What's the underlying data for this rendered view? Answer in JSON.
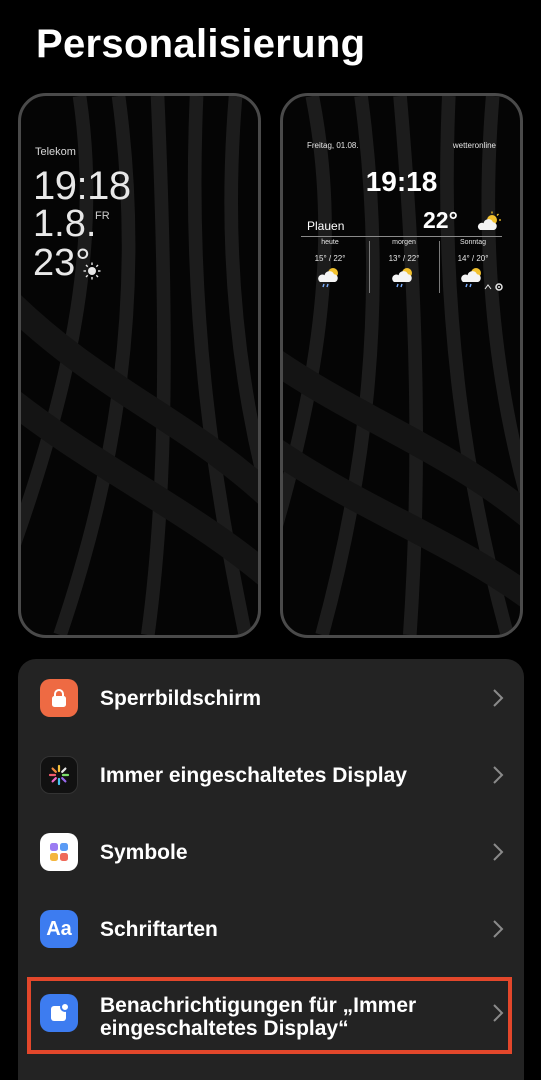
{
  "header": {
    "title": "Personalisierung"
  },
  "preview_aod": {
    "carrier": "Telekom",
    "time": "19:18",
    "date": "1.8.",
    "day": "FR",
    "temperature": "23°",
    "weather_icon": "sun-icon"
  },
  "preview_widget": {
    "date": "Freitag, 01.08.",
    "brand": "wetteronline",
    "time": "19:18",
    "city": "Plauen",
    "temperature": "22°",
    "forecast": [
      {
        "label": "heute",
        "temps": "15° / 22°",
        "icon": "partly-cloudy-rain-icon"
      },
      {
        "label": "morgen",
        "temps": "13° / 22°",
        "icon": "partly-cloudy-rain-icon"
      },
      {
        "label": "Sonntag",
        "temps": "14° / 20°",
        "icon": "partly-cloudy-rain-icon"
      }
    ]
  },
  "menu": {
    "items": [
      {
        "label": "Sperrbildschirm",
        "icon": "lock-icon"
      },
      {
        "label": "Immer eingeschaltetes Display",
        "icon": "aod-icon"
      },
      {
        "label": "Symbole",
        "icon": "grid-icon"
      },
      {
        "label": "Schriftarten",
        "icon": "font-icon",
        "icon_text": "Aa"
      },
      {
        "label": "Benachrichtigungen für „Immer eingeschaltetes Display“",
        "icon": "notification-icon"
      }
    ]
  },
  "colors": {
    "highlight": "#e3472b",
    "panel": "#232323",
    "accent_blue": "#3d7cf0",
    "lock_orange": "#ee6a43"
  }
}
